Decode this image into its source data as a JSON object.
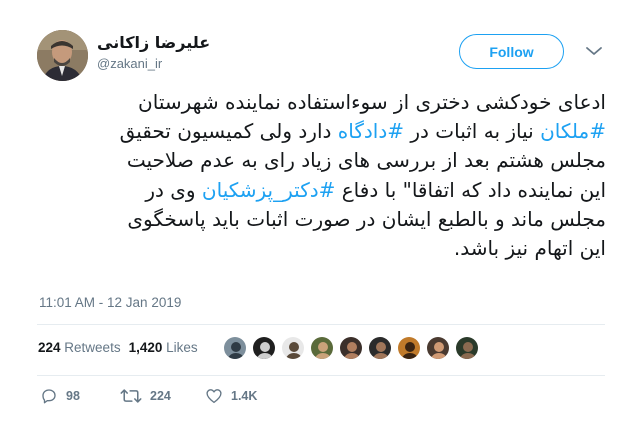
{
  "user": {
    "name": "علیرضا زاکانی",
    "handle": "@zakani_ir"
  },
  "follow_label": "Follow",
  "tweet": {
    "lines": [
      [
        {
          "t": "ادعای خودکشی دختری از سوءاستفاده نماینده شهرستان"
        }
      ],
      [
        {
          "t": "#ملکان",
          "tag": true
        },
        {
          "t": " نیاز به اثبات در "
        },
        {
          "t": "#دادگاه",
          "tag": true
        },
        {
          "t": " دارد ولی کمیسیون تحقیق"
        }
      ],
      [
        {
          "t": "مجلس هشتم بعد از بررسی های زیاد رای به عدم صلاحیت"
        }
      ],
      [
        {
          "t": "این نماینده داد که اتفاقا\" با دفاع "
        },
        {
          "t": "#دکتر_پزشکیان",
          "tag": true
        },
        {
          "t": " وی در"
        }
      ],
      [
        {
          "t": "مجلس ماند و بالطبع ایشان در صورت اثبات باید پاسخگوی"
        }
      ],
      [
        {
          "t": "این اتهام نیز باشد."
        }
      ]
    ]
  },
  "timestamp": "11:01 AM - 12 Jan 2019",
  "stats": {
    "retweets_count": "224",
    "retweets_label": "Retweets",
    "likes_count": "1,420",
    "likes_label": "Likes"
  },
  "likers": [
    {
      "bg": "#7d8f9c",
      "fg": "#2f3b45"
    },
    {
      "bg": "#1f1f1f",
      "fg": "#cfcfcf"
    },
    {
      "bg": "#e8e8e8",
      "fg": "#5a4a3a"
    },
    {
      "bg": "#5a6a3a",
      "fg": "#c9a27a"
    },
    {
      "bg": "#3b2f2a",
      "fg": "#b07e5f"
    },
    {
      "bg": "#2b2b2b",
      "fg": "#a0765a"
    },
    {
      "bg": "#c07a2a",
      "fg": "#3a2412"
    },
    {
      "bg": "#4a3a30",
      "fg": "#d09a74"
    },
    {
      "bg": "#2a3a2a",
      "fg": "#8a6a50"
    }
  ],
  "actions": {
    "replies": "98",
    "retweets": "224",
    "likes": "1.4K"
  },
  "colors": {
    "accent": "#1da1f2",
    "muted": "#657786",
    "retweet_green": "#17bf63",
    "like_red": "#e0245e"
  },
  "icons": {
    "reply": "reply-icon",
    "retweet": "retweet-icon",
    "like": "heart-icon",
    "caret": "chevron-down-icon"
  }
}
